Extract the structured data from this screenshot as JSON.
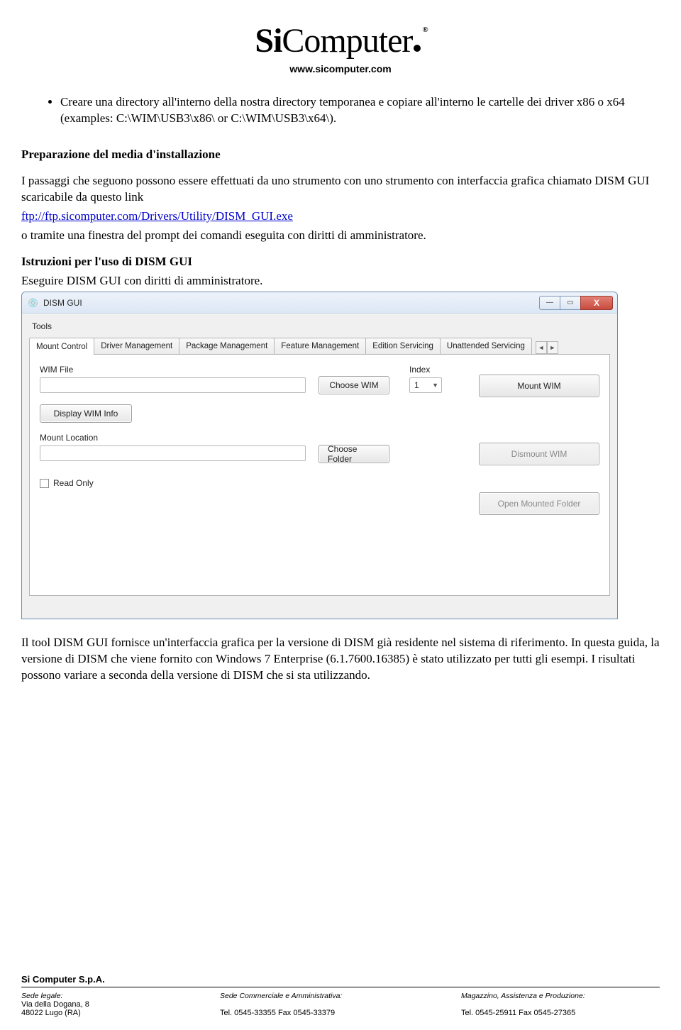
{
  "header": {
    "logo_prefix": "Si",
    "logo_suffix": "Computer",
    "website": "www.sicomputer.com"
  },
  "bullets": [
    "Creare una directory all'interno della nostra directory temporanea e copiare all'interno le cartelle dei driver x86 o x64 (examples: C:\\WIM\\USB3\\x86\\ or C:\\WIM\\USB3\\x64\\)."
  ],
  "section1": {
    "title": "Preparazione del media d'installazione",
    "para1": "I passaggi che seguono possono essere effettuati da uno strumento con uno strumento con interfaccia grafica chiamato DISM GUI scaricabile da questo link",
    "link": "ftp://ftp.sicomputer.com/Drivers/Utility/DISM_GUI.exe",
    "para_post": " o tramite una finestra del prompt dei comandi eseguita con diritti di amministratore.",
    "subtitle": "Istruzioni per l'uso di DISM GUI",
    "para2": "Eseguire DISM GUI con diritti di amministratore."
  },
  "win": {
    "title": "DISM GUI",
    "tools": "Tools",
    "tabs": [
      "Mount Control",
      "Driver Management",
      "Package Management",
      "Feature Management",
      "Edition Servicing",
      "Unattended Servicing"
    ],
    "wim_file_label": "WIM File",
    "choose_wim": "Choose WIM",
    "index_label": "Index",
    "index_value": "1",
    "mount_wim": "Mount WIM",
    "display_wim_info": "Display WIM Info",
    "mount_location_label": "Mount Location",
    "choose_folder": "Choose Folder",
    "dismount_wim": "Dismount WIM",
    "read_only": "Read Only",
    "open_mounted_folder": "Open Mounted Folder"
  },
  "para_bottom": "Il tool DISM GUI fornisce un'interfaccia grafica per la versione di DISM già residente nel sistema di riferimento. In questa guida, la versione di DISM che viene fornito con Windows 7 Enterprise (6.1.7600.16385) è stato utilizzato per tutti gli esempi. I risultati possono variare a seconda della versione di DISM che si sta utilizzando.",
  "footer": {
    "company": "Si Computer S.p.A.",
    "col1_label": "Sede legale:",
    "col1_addr1": "Via della Dogana, 8",
    "col1_addr2": "48022 Lugo (RA)",
    "col2_label": "Sede Commerciale e Amministrativa:",
    "col2_tel": "Tel. 0545-33355 Fax 0545-33379",
    "col3_label": "Magazzino, Assistenza e Produzione:",
    "col3_tel": "Tel. 0545-25911 Fax 0545-27365"
  }
}
